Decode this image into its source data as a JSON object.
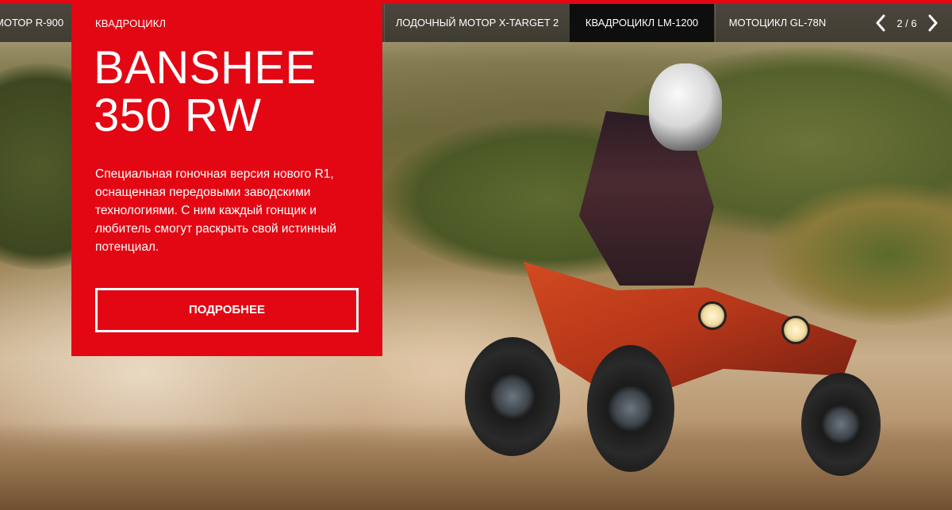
{
  "nav": {
    "items": [
      {
        "label": "Мотор R-900"
      },
      {
        "label": "Лодочный мотор X-Target 2"
      },
      {
        "label": "Квадроцикл LM-1200",
        "active": true
      },
      {
        "label": "Мотоцикл GL-78N"
      }
    ],
    "pager": {
      "current": 2,
      "total": 6,
      "text": "2 / 6"
    },
    "prev_icon": "chevron-left-icon",
    "next_icon": "chevron-right-icon"
  },
  "slide": {
    "category": "Квадроцикл",
    "title": "Banshee 350 RW",
    "description": "Специальная гоночная версия нового R1, оснащенная передовыми заводскими технологиями. С ним каждый гонщик и любитель смогут раскрыть свой истинный потенциал.",
    "button_label": "Подробнее",
    "image": "atv-rider-photo"
  },
  "colors": {
    "accent": "#e30613",
    "nav_background": "#1c1c1c",
    "nav_active": "#0e0e0e",
    "text": "#ffffff"
  }
}
